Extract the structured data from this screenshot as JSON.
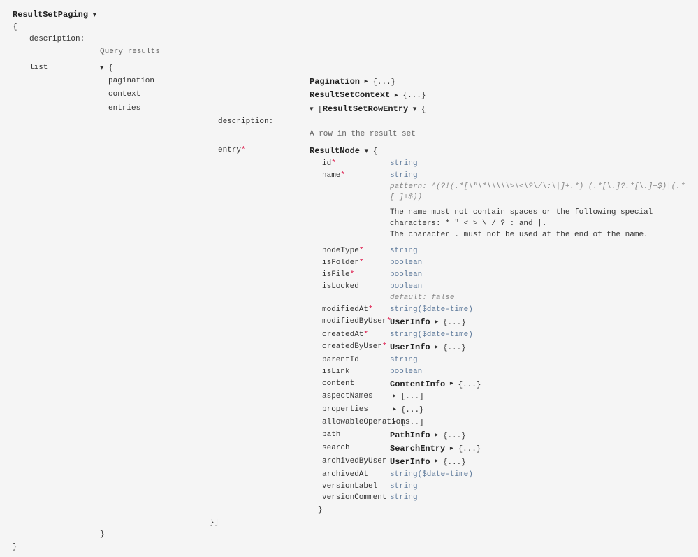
{
  "root": {
    "name": "ResultSetPaging",
    "description_label": "description:",
    "description_value": "Query results",
    "list_label": "list",
    "pagination_label": "pagination",
    "context_label": "context",
    "entries_label": "entries"
  },
  "pagination": {
    "name": "Pagination"
  },
  "resultsetcontext": {
    "name": "ResultSetContext"
  },
  "rowentry": {
    "open_bracket": "[",
    "name": "ResultSetRowEntry",
    "description_label": "description:",
    "description_value": "A row in the result set",
    "entry_label": "entry"
  },
  "resultnode": {
    "name": "ResultNode",
    "props": {
      "id": {
        "name": "id",
        "req": "*",
        "type": "string"
      },
      "name": {
        "name": "name",
        "req": "*",
        "type": "string"
      },
      "pattern_label": "pattern:",
      "pattern_value": "^(?!(.*[\\\"\\*\\\\\\\\\\>\\<\\?\\/\\:\\|]+.*)|(.*[\\.]?.*[\\.]+$)|(.*[ ]+$))",
      "note1": "The name must not contain spaces or the following special characters: * \" < > \\ / ? : and |.",
      "note2": "The character . must not be used at the end of the name.",
      "nodeType": {
        "name": "nodeType",
        "req": "*",
        "type": "string"
      },
      "isFolder": {
        "name": "isFolder",
        "req": "*",
        "type": "boolean"
      },
      "isFile": {
        "name": "isFile",
        "req": "*",
        "type": "boolean"
      },
      "isLocked": {
        "name": "isLocked",
        "type": "boolean"
      },
      "default_label": "default:",
      "default_value": "false",
      "modifiedAt": {
        "name": "modifiedAt",
        "req": "*",
        "type": "string($date-time)"
      },
      "modifiedByUser": {
        "name": "modifiedByUser",
        "req": "*"
      },
      "createdAt": {
        "name": "createdAt",
        "req": "*",
        "type": "string($date-time)"
      },
      "createdByUser": {
        "name": "createdByUser",
        "req": "*"
      },
      "parentId": {
        "name": "parentId",
        "type": "string"
      },
      "isLink": {
        "name": "isLink",
        "type": "boolean"
      },
      "content": {
        "name": "content"
      },
      "aspectNames": {
        "name": "aspectNames"
      },
      "properties": {
        "name": "properties"
      },
      "allowableOperations": {
        "name": "allowableOperations"
      },
      "path": {
        "name": "path"
      },
      "search": {
        "name": "search"
      },
      "archivedByUser": {
        "name": "archivedByUser"
      },
      "archivedAt": {
        "name": "archivedAt",
        "type": "string($date-time)"
      },
      "versionLabel": {
        "name": "versionLabel",
        "type": "string"
      },
      "versionComment": {
        "name": "versionComment",
        "type": "string"
      }
    }
  },
  "refs": {
    "userinfo": "UserInfo",
    "contentinfo": "ContentInfo",
    "pathinfo": "PathInfo",
    "searchentry": "SearchEntry",
    "collapsed_obj": "{...}",
    "collapsed_arr": "[...]",
    "close_brace": "}",
    "open_brace": "{",
    "close_paren_bracket": "}]"
  }
}
